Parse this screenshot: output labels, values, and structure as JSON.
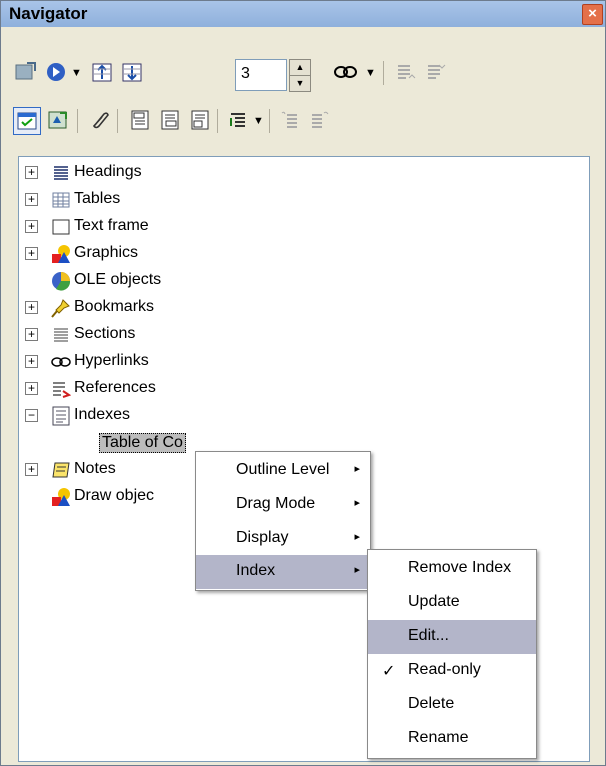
{
  "window": {
    "title": "Navigator",
    "close_glyph": "×"
  },
  "toolbar": {
    "row1": [
      {
        "name": "toggle-icon"
      },
      {
        "name": "navigation-icon"
      },
      {
        "name": "previous-icon"
      },
      {
        "name": "next-icon"
      },
      {
        "name": "drag-mode-icon"
      },
      {
        "name": "promote-level-icon"
      },
      {
        "name": "demote-level-icon"
      }
    ],
    "outline_level_value": "3",
    "row2": [
      {
        "name": "content-view-icon"
      },
      {
        "name": "set-reminder-icon"
      },
      {
        "name": "header-icon"
      },
      {
        "name": "footer-icon"
      },
      {
        "name": "anchor-icon"
      },
      {
        "name": "heading-levels-icon"
      },
      {
        "name": "promote-chapter-icon"
      },
      {
        "name": "demote-chapter-icon"
      }
    ],
    "spin_up": "▲",
    "spin_down": "▼",
    "dropdown_glyph": "▼"
  },
  "tree": {
    "items": [
      {
        "label": "Headings",
        "expander": "+",
        "icon": "headings-icon"
      },
      {
        "label": "Tables",
        "expander": "+",
        "icon": "tables-icon"
      },
      {
        "label": "Text frame",
        "expander": "+",
        "icon": "text-frame-icon"
      },
      {
        "label": "Graphics",
        "expander": "+",
        "icon": "graphics-icon"
      },
      {
        "label": "OLE objects",
        "expander": "",
        "icon": "ole-objects-icon"
      },
      {
        "label": "Bookmarks",
        "expander": "+",
        "icon": "bookmarks-icon"
      },
      {
        "label": "Sections",
        "expander": "+",
        "icon": "sections-icon"
      },
      {
        "label": "Hyperlinks",
        "expander": "+",
        "icon": "hyperlinks-icon"
      },
      {
        "label": "References",
        "expander": "+",
        "icon": "references-icon"
      },
      {
        "label": "Indexes",
        "expander": "−",
        "icon": "indexes-icon"
      },
      {
        "label": "Table of Co",
        "expander": "",
        "icon": ""
      },
      {
        "label": "Notes",
        "expander": "+",
        "icon": "notes-icon"
      },
      {
        "label": "Draw objec",
        "expander": "",
        "icon": "draw-objects-icon"
      }
    ]
  },
  "context_menu": {
    "items": [
      {
        "label": "Outline Level",
        "submenu": "▸"
      },
      {
        "label": "Drag Mode",
        "submenu": "▸"
      },
      {
        "label": "Display",
        "submenu": "▸"
      },
      {
        "label": "Index",
        "submenu": "▸",
        "highlighted": true
      }
    ]
  },
  "index_submenu": {
    "items": [
      {
        "label": "Remove Index"
      },
      {
        "label": "Update"
      },
      {
        "label": "Edit...",
        "highlighted": true
      },
      {
        "label": "Read-only",
        "checked": true,
        "check": "✓"
      },
      {
        "label": "Delete"
      },
      {
        "label": "Rename"
      }
    ]
  },
  "colors": {
    "highlight": "#b3b5c9",
    "titlebar": "#8fb0dc",
    "close": "#e4704a"
  }
}
